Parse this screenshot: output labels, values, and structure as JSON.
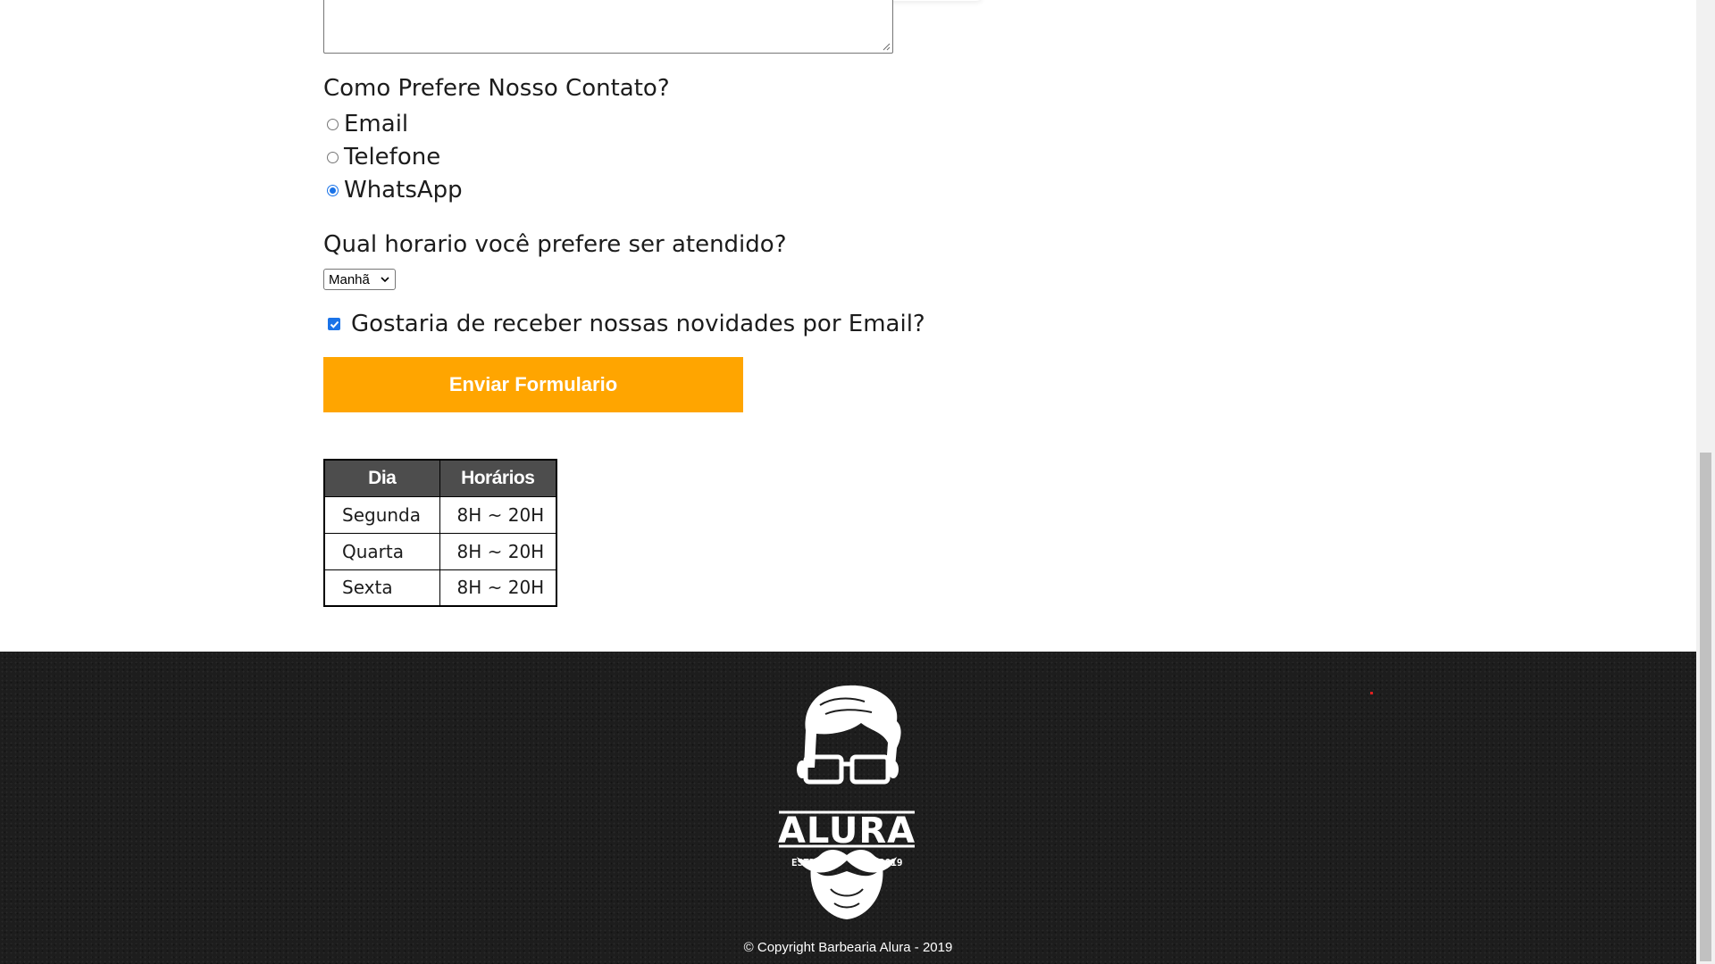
{
  "form": {
    "contact_question": "Como Prefere Nosso Contato?",
    "contact_options": [
      {
        "label": "Email",
        "checked": false
      },
      {
        "label": "Telefone",
        "checked": false
      },
      {
        "label": "WhatsApp",
        "checked": true
      }
    ],
    "time_question": "Qual horario você prefere ser atendido?",
    "time_select_value": "Manhã",
    "newsletter_label": "Gostaria de receber nossas novidades por Email?",
    "newsletter_checked": true,
    "submit_label": "Enviar Formulario"
  },
  "schedule": {
    "headers": [
      "Dia",
      "Horários"
    ],
    "rows": [
      [
        "Segunda",
        "8H ~ 20H"
      ],
      [
        "Quarta",
        "8H ~ 20H"
      ],
      [
        "Sexta",
        "8H ~ 20H"
      ]
    ]
  },
  "footer": {
    "logo_text": "ALURA",
    "logo_left": "ESTD",
    "logo_right": "2019",
    "copyright": "© Copyright Barbearia Alura - 2019"
  },
  "colors": {
    "accent": "#ffa500",
    "table_header": "#4d4d4d",
    "footer_bg": "#1d1d1d",
    "checkbox": "#1a73e8"
  },
  "icons": {
    "select_arrow": "chevron-down-icon",
    "checkbox_mark": "check-icon",
    "resize": "resize-grip-icon"
  }
}
